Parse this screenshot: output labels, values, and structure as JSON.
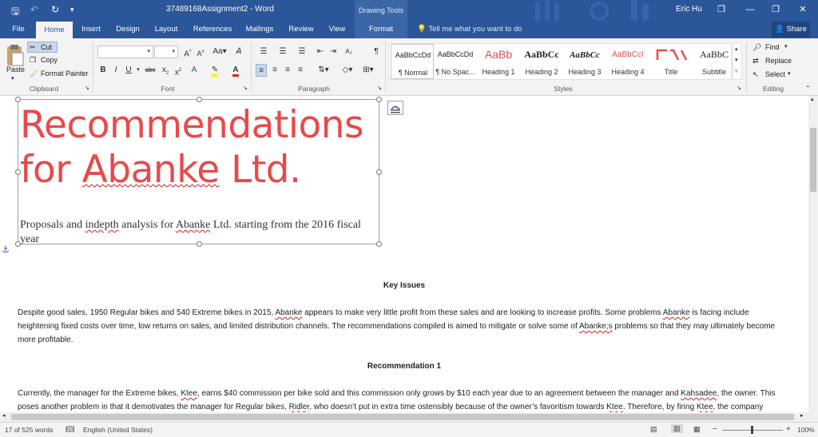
{
  "window": {
    "doc_title": "37489168Assignment2  -  Word",
    "context_label": "Drawing Tools",
    "user_name": "Eric Hu"
  },
  "tabs": [
    "File",
    "Home",
    "Insert",
    "Design",
    "Layout",
    "References",
    "Mailings",
    "Review",
    "View",
    "Format"
  ],
  "tellme_placeholder": "Tell me what you want to do",
  "share_label": "Share",
  "clipboard": {
    "paste": "Paste",
    "cut": "Cut",
    "copy": "Copy",
    "format_painter": "Format Painter",
    "group": "Clipboard"
  },
  "font": {
    "name_value": "",
    "size_value": "",
    "group": "Font"
  },
  "paragraph": {
    "group": "Paragraph"
  },
  "styles": {
    "group": "Styles",
    "items": [
      {
        "preview": "AaBbCcDd",
        "name": "¶ Normal"
      },
      {
        "preview": "AaBbCcDd",
        "name": "¶ No Spac..."
      },
      {
        "preview": "AaBb",
        "name": "Heading 1"
      },
      {
        "preview": "AaBbCc",
        "name": "Heading 2"
      },
      {
        "preview": "AaBbCc",
        "name": "Heading 3"
      },
      {
        "preview": "AaBbCcI",
        "name": "Heading 4"
      },
      {
        "preview": "",
        "name": "Title"
      },
      {
        "preview": "AaBbC",
        "name": "Subtitle"
      }
    ]
  },
  "editing": {
    "find": "Find",
    "replace": "Replace",
    "select": "Select",
    "group": "Editing"
  },
  "document": {
    "title_line1": "Recommendations",
    "title_line2_pre": "for ",
    "title_line2_word": "Abanke",
    "title_line2_post": " Ltd.",
    "subtitle_pre": "Proposals and ",
    "subtitle_word1": "indepth",
    "subtitle_mid": " analysis for ",
    "subtitle_word2": "Abanke",
    "subtitle_post": " Ltd. starting from the 2016 fiscal year",
    "heading1": "Key Issues",
    "para1_a": "Despite good sales, 1950 Regular bikes and 540 Extreme bikes in 2015, ",
    "para1_w1": "Abanke",
    "para1_b": " appears to make very little profit from these sales and are looking to increase profits. Some problems ",
    "para1_w2": "Abanke",
    "para1_c": " is facing include heightening fixed costs over time, low returns on sales, and limited distribution channels. The recommendations compiled is aimed to mitigate or solve some of ",
    "para1_w3": "Abanke;s",
    "para1_d": " problems so that they may ultimately become more profitable.",
    "heading2": "Recommendation 1",
    "para2_a": "Currently, the manager for the Extreme bikes, ",
    "para2_w1": "Ktee",
    "para2_b": ", earns $40 commission per bike sold and this commission only grows by $10 each year due to an agreement between the manager and ",
    "para2_w2": "Kahsadee",
    "para2_c": ", the owner. This poses another problem in that it demotivates the manager for Regular bikes, ",
    "para2_w3": "Ridler",
    "para2_d": ", who doesn’t put in extra time ostensibly because of the owner’s favoritism towards ",
    "para2_w4": "Ktee",
    "para2_e": ". Therefore, by firing ",
    "para2_w5": "Ktee",
    "para2_f": ", the company"
  },
  "status": {
    "words": "17 of 525 words",
    "language": "English (United States)",
    "zoom": "100%"
  },
  "colors": {
    "brand": "#2b579a",
    "title_red": "#e8494a"
  }
}
